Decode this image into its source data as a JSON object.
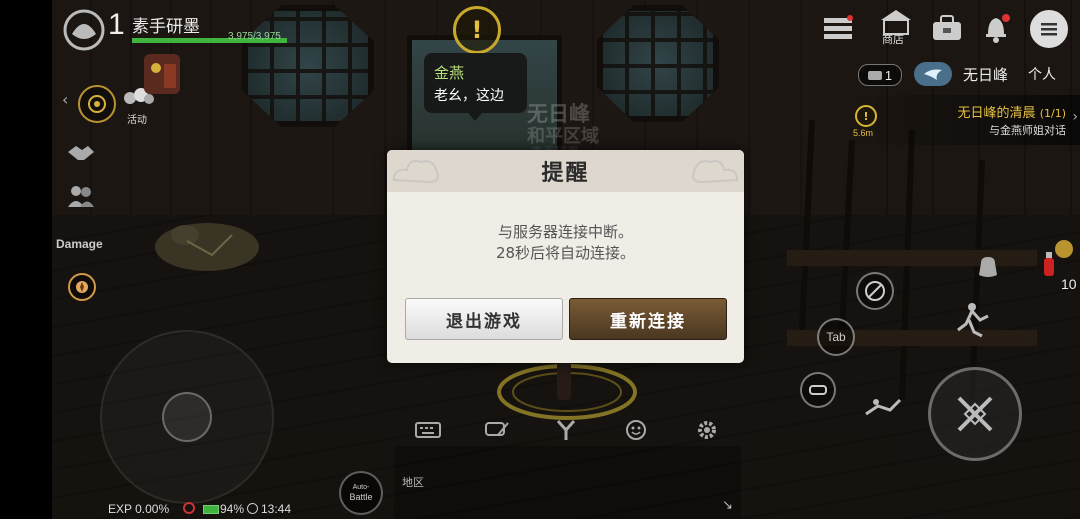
{
  "player": {
    "level": "1",
    "name": "素手研墨",
    "hp": "3,975/3,975"
  },
  "side_menu": {
    "activity_label": "活动",
    "damage_label": "Damage"
  },
  "npc": {
    "name": "金燕",
    "speech": "老幺，这边"
  },
  "zone": {
    "name": "无日峰",
    "sub": "和平区域",
    "extra": "素手研墨"
  },
  "top_right": {
    "shop_label": "商店",
    "personal_label": "个人",
    "ticket_count": "1",
    "location": "无日峰"
  },
  "quest": {
    "title": "无日峰的清晨",
    "progress": "(1/1)",
    "desc": "与金燕师姐对话",
    "distance": "5.6m"
  },
  "potion_count": "10",
  "dialog": {
    "title": "提醒",
    "line1": "与服务器连接中断。",
    "line2": "28秒后将自动连接。",
    "exit_label": "退出游戏",
    "reconnect_label": "重新连接"
  },
  "skills": {
    "tab_label": "Tab"
  },
  "chat": {
    "region_label": "地区"
  },
  "auto_battle": {
    "line1": "Auto-",
    "line2": "Battle"
  },
  "status": {
    "exp": "EXP 0.00%",
    "battery": "94%",
    "time": "13:44"
  },
  "colors": {
    "hp_green": "#3fb43f",
    "quest_yellow": "#e6c040",
    "npc_green": "#b8e07a"
  }
}
